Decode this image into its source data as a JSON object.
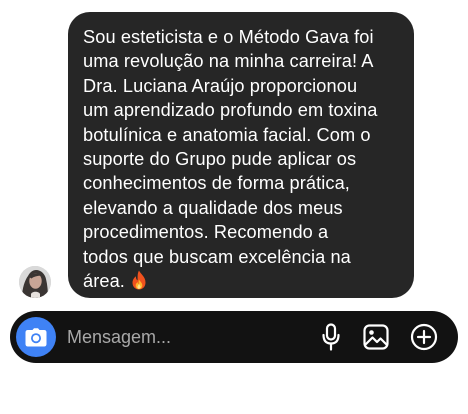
{
  "message": {
    "text": "Sou esteticista e o Método Gava foi\numa revolução na minha carreira! A\nDra. Luciana Araújo proporcionou\num aprendizado profundo em toxina\nbotulínica e anatomia facial. Com o\nsuporte do Grupo pude aplicar os\nconhecimentos de forma prática,\nelevando a qualidade dos meus\nprocedimentos. Recomendo a\ntodos que buscam excelência na\nárea.",
    "emoji": "fire-emoji"
  },
  "composer": {
    "placeholder": "Mensagem...",
    "icons": {
      "camera": "camera-icon",
      "microphone": "microphone-icon",
      "gallery": "gallery-icon",
      "add": "plus-circle-icon"
    }
  },
  "colors": {
    "bubble": "#262626",
    "composer": "#121212",
    "camera_button": "#3f82f5",
    "placeholder": "#a8a8a8"
  }
}
